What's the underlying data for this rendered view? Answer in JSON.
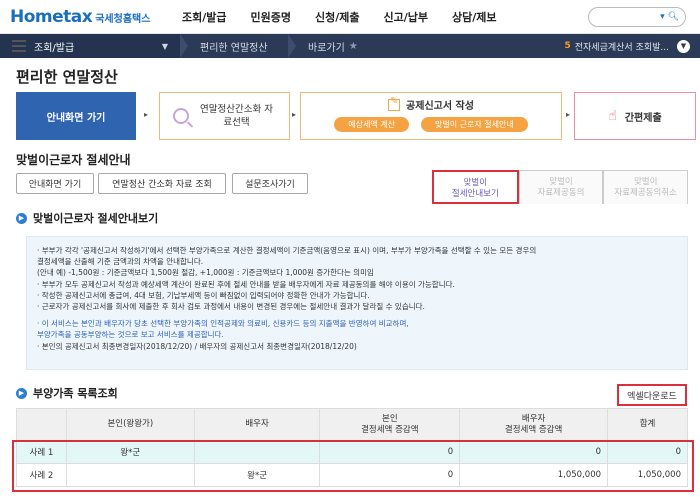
{
  "header": {
    "logo_main": "Hometax",
    "logo_sub": "국세청홈택스",
    "gnb": [
      "조회/발급",
      "민원증명",
      "신청/제출",
      "신고/납부",
      "상담/제보"
    ]
  },
  "navbar": {
    "current": "조회/발급",
    "crumb1": "편리한 연말정산",
    "crumb2": "바로가기",
    "notice_count": "5",
    "notice_text": "전자세금계산서 조회발..."
  },
  "page_title": "편리한 연말정산",
  "steps": {
    "step1": "안내화면 가기",
    "step2": "연말정산간소화 자료선택",
    "step3_title": "공제신고서 작성",
    "step3_btn1": "예상세액 계산",
    "step3_btn2": "맞벌이 근로자 절세안내",
    "step4": "간편제출"
  },
  "section_title": "맞벌이근로자 절세안내",
  "buttons": {
    "b1": "안내화면 가기",
    "b2": "연말정산 간소화 자료 조회",
    "b3": "설문조사가기"
  },
  "tabs": [
    {
      "line1": "맞벌이",
      "line2": "절세안내보기"
    },
    {
      "line1": "맞벌이",
      "line2": "자료제공동의"
    },
    {
      "line1": "맞벌이",
      "line2": "자료제공동의취소"
    }
  ],
  "info_title": "맞벌이근로자 절세안내보기",
  "info_lines": [
    "· 부부가 각각 '공제신고서 작성하기'에서 선택한 부양가족으로 계산한 결정세액이 기준금액(음영으로 표시) 이며, 부부가 부양가족을 선택할 수 있는 모든 경우의",
    "  결정세액을 산출해 기준 금액과의 차액을 안내합니다.",
    "  (안내 예) -1,500원 : 기준금액보다 1,500원 절감, +1,000원 : 기준금액보다 1,000원 증가한다는 의미임",
    "· 부부가 모두 공제신고서 작성과 예상세액 계산이 완료된 후에 절세 안내를 받을 배우자에게 자료 제공동의를 해야 이용이 가능합니다.",
    "· 작성한 공제신고서에 총급여, 4대 보험, 기납부세액 등이 빠짐없이 입력되어야 정확한 안내가 가능합니다.",
    "· 근로자가 공제신고서를 회사에 제출한 후 회사 검토 과정에서 내용이 변경된 경우에는 절세안내 결과가 달라질 수 있습니다."
  ],
  "info_blue_lines": [
    "· 이 서비스는 본인과 배우자가 당초 선택한 부양가족의 인적공제와 의료비, 신용카드 등의 지출액을 반영하여 비교하며,",
    "  부양가족을 공동부양하는 것으로 보고 서비스를 제공합니다."
  ],
  "info_last": "· 본인의 공제신고서 최종변경일자(2018/12/20) / 배우자의 공제신고서 최종변경일자(2018/12/20)",
  "table_title": "부양가족 목록조회",
  "excel_button": "엑셀다운로드",
  "table": {
    "headers": [
      "",
      "본인(왕왕가)",
      "배우자",
      "본인\n결정세액 증감액",
      "배우자\n결정세액 증감액",
      "합계"
    ],
    "h3_line1": "본인",
    "h3_line2": "결정세액 증감액",
    "h4_line1": "배우자",
    "h4_line2": "결정세액 증감액",
    "rows": [
      {
        "case": "사례 1",
        "self": "왕*군",
        "spouse": "",
        "self_amt": "0",
        "spouse_amt": "0",
        "total": "0"
      },
      {
        "case": "사례 2",
        "self": "",
        "spouse": "왕*군",
        "self_amt": "0",
        "spouse_amt": "1,050,000",
        "total": "1,050,000"
      }
    ]
  }
}
